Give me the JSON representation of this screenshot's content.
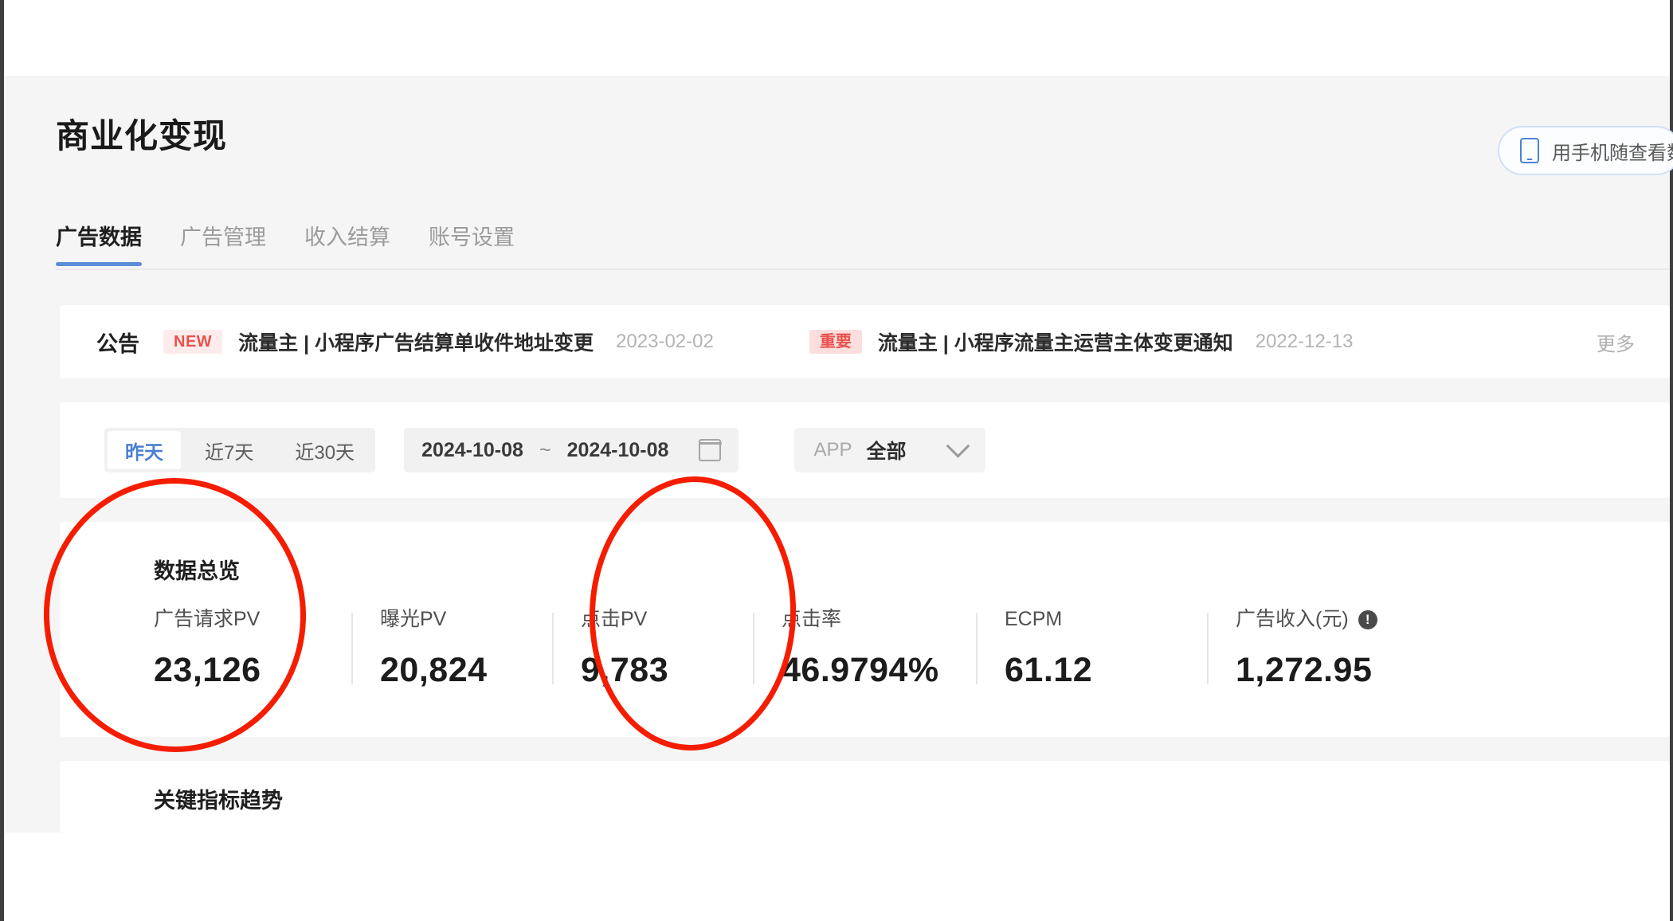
{
  "header": {
    "title": "商业化变现",
    "phone_button": {
      "label": "用手机随查看数",
      "icon": "phone-icon"
    }
  },
  "tabs": [
    {
      "label": "广告数据",
      "active": true
    },
    {
      "label": "广告管理",
      "active": false
    },
    {
      "label": "收入结算",
      "active": false
    },
    {
      "label": "账号设置",
      "active": false
    }
  ],
  "announcement": {
    "title": "公告",
    "more_label": "更多",
    "items": [
      {
        "badge": "NEW",
        "badge_type": "new",
        "text": "流量主 | 小程序广告结算单收件地址变更",
        "date": "2023-02-02"
      },
      {
        "badge": "重要",
        "badge_type": "important",
        "text": "流量主 | 小程序流量主运营主体变更通知",
        "date": "2022-12-13"
      }
    ]
  },
  "filters": {
    "quick_ranges": [
      {
        "label": "昨天",
        "active": true
      },
      {
        "label": "近7天",
        "active": false
      },
      {
        "label": "近30天",
        "active": false
      }
    ],
    "date_start": "2024-10-08",
    "date_separator": "~",
    "date_end": "2024-10-08",
    "calendar_icon": "calendar-icon",
    "app_select": {
      "label": "APP",
      "value": "全部",
      "chevron_icon": "chevron-down-icon"
    }
  },
  "overview": {
    "title": "数据总览",
    "metrics": [
      {
        "label": "广告请求PV",
        "value": "23,126",
        "info": false
      },
      {
        "label": "曝光PV",
        "value": "20,824",
        "info": false
      },
      {
        "label": "点击PV",
        "value": "9,783",
        "info": false
      },
      {
        "label": "点击率",
        "value": "46.9794%",
        "info": false
      },
      {
        "label": "ECPM",
        "value": "61.12",
        "info": false
      },
      {
        "label": "广告收入(元)",
        "value": "1,272.95",
        "info": true
      }
    ]
  },
  "trend": {
    "title": "关键指标趋势"
  },
  "annotations": {
    "color": "#f51d00",
    "shapes": [
      {
        "name": "highlight-ad-request-pv",
        "shape": "ellipse"
      },
      {
        "name": "highlight-click-pv",
        "shape": "ellipse"
      }
    ]
  }
}
